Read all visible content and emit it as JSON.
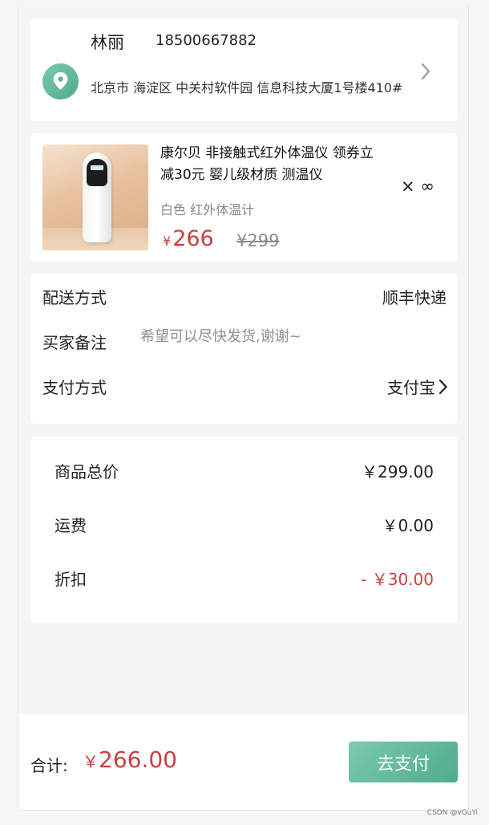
{
  "address": {
    "name": "林丽",
    "phone": "18500667882",
    "detail": "北京市 海淀区 中关村软件园 信息科技大厦1号楼410#"
  },
  "product": {
    "title": "康尔贝 非接触式红外体温仪 领券立减30元 婴儿级材质 测温仪",
    "spec": "白色 红外体温计",
    "currency": "¥",
    "price": "266",
    "original_price": "¥299",
    "quantity": "× ∞"
  },
  "info": {
    "delivery_label": "配送方式",
    "delivery_value": "顺丰快递",
    "note_label": "买家备注",
    "note_placeholder": "希望可以尽快发货,谢谢~",
    "payment_label": "支付方式",
    "payment_value": "支付宝"
  },
  "totals": {
    "goods_label": "商品总价",
    "goods_value": "￥299.00",
    "shipping_label": "运费",
    "shipping_value": "￥0.00",
    "discount_label": "折扣",
    "discount_value": "- ￥30.00"
  },
  "footer": {
    "sum_label": "合计:",
    "sum_currency": "￥",
    "sum_value": "266.00",
    "pay_button": "去支付"
  },
  "watermark": "CSDN @vGuYi",
  "colors": {
    "accent": "#5cb596",
    "price_red": "#c94040"
  },
  "icons": {
    "location": "location-pin-icon",
    "address_arrow": "chevron-right-icon",
    "payment_arrow": "chevron-right-icon"
  }
}
